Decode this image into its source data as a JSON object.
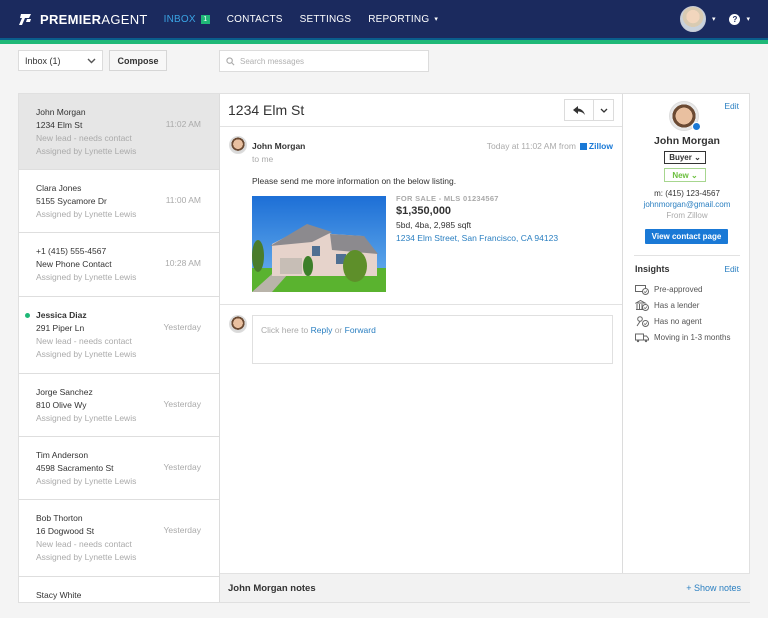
{
  "app": {
    "brand_bold": "PREMIER",
    "brand_light": "AGENT"
  },
  "nav": {
    "items": [
      {
        "label": "INBOX",
        "badge": "1",
        "active": true
      },
      {
        "label": "CONTACTS"
      },
      {
        "label": "SETTINGS"
      },
      {
        "label": "REPORTING",
        "dropdown": true
      }
    ],
    "help_icon": "?",
    "caret": "▾"
  },
  "toolbar": {
    "folder_select": "Inbox (1)",
    "compose_label": "Compose",
    "search_placeholder": "Search messages"
  },
  "inbox": {
    "items": [
      {
        "name": "John Morgan",
        "address": "1234 Elm St",
        "status": "New lead - needs contact",
        "assigned": "Assigned by Lynette Lewis",
        "time": "11:02 AM",
        "selected": true
      },
      {
        "name": "Clara Jones",
        "address": "5155 Sycamore Dr",
        "assigned": "Assigned by Lynette Lewis",
        "time": "11:00 AM"
      },
      {
        "name": "+1 (415) 555-4567",
        "address": "New Phone Contact",
        "assigned": "Assigned by Lynette Lewis",
        "time": "10:28 AM"
      },
      {
        "name": "Jessica Diaz",
        "address": "291 Piper Ln",
        "status": "New lead - needs contact",
        "assigned": "Assigned by Lynette Lewis",
        "time": "Yesterday",
        "unread": true
      },
      {
        "name": "Jorge Sanchez",
        "address": "810 Olive Wy",
        "assigned": "Assigned by Lynette Lewis",
        "time": "Yesterday"
      },
      {
        "name": "Tim Anderson",
        "address": "4598 Sacramento St",
        "assigned": "Assigned by Lynette Lewis",
        "time": "Yesterday"
      },
      {
        "name": "Bob Thorton",
        "address": "16 Dogwood St",
        "status": "New lead - needs contact",
        "assigned": "Assigned by Lynette Lewis",
        "time": "Yesterday"
      },
      {
        "name": "Stacy White"
      }
    ]
  },
  "conversation": {
    "title": "1234 Elm St",
    "reply_icon": "reply-arrow",
    "more_icon": "chevron-down",
    "message": {
      "sender": "John Morgan",
      "to": "to me",
      "timestamp": "Today at 11:02 AM from",
      "source": "Zillow",
      "body": "Please send me more information on the below listing.",
      "listing": {
        "status": "FOR SALE - MLS 01234567",
        "price": "$1,350,000",
        "specs": "5bd, 4ba, 2,985 sqft",
        "address": "1234 Elm Street, San Francisco, CA 94123"
      }
    },
    "reply": {
      "prefix": "Click here to ",
      "reply_label": "Reply",
      "or": " or ",
      "forward_label": "Forward"
    },
    "notes": {
      "title": "John Morgan notes",
      "show_label": "+ Show notes"
    }
  },
  "contact": {
    "edit_label": "Edit",
    "name": "John Morgan",
    "type": "Buyer ⌄",
    "stage": "New ⌄",
    "phone": "m: (415) 123-4567",
    "email": "johnmorgan@gmail.com",
    "source": "From Zillow",
    "view_label": "View contact page",
    "insights": {
      "title": "Insights",
      "edit_label": "Edit",
      "items": [
        {
          "icon": "pre-approved-icon",
          "label": "Pre-approved"
        },
        {
          "icon": "lender-icon",
          "label": "Has a lender"
        },
        {
          "icon": "no-agent-icon",
          "label": "Has no agent"
        },
        {
          "icon": "moving-truck-icon",
          "label": "Moving in 1-3 months"
        }
      ]
    }
  },
  "colors": {
    "nav_bg": "#1b2a5e",
    "accent_green": "#1fb877",
    "link_blue": "#2a7fc1",
    "button_blue": "#1a79d6"
  }
}
